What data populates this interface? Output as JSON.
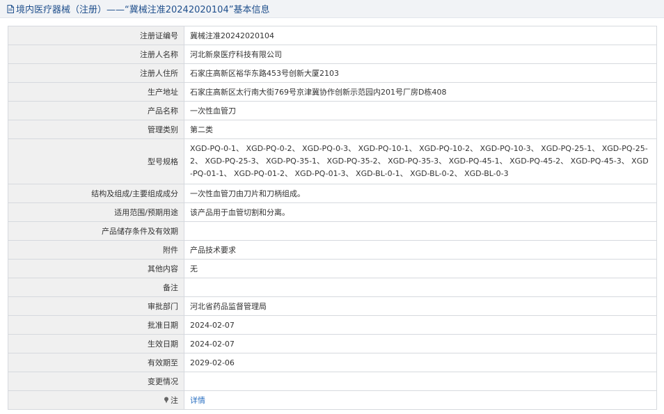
{
  "header": {
    "icon": "document-icon",
    "title": "境内医疗器械（注册）——“冀械注准20242020104”基本信息"
  },
  "rows": [
    {
      "label": "注册证编号",
      "value": "冀械注准20242020104"
    },
    {
      "label": "注册人名称",
      "value": "河北新泉医疗科技有限公司"
    },
    {
      "label": "注册人住所",
      "value": "石家庄高新区裕华东路453号创新大厦2103"
    },
    {
      "label": "生产地址",
      "value": "石家庄高新区太行南大街769号京津冀协作创新示范园内201号厂房D栋408"
    },
    {
      "label": "产品名称",
      "value": "一次性血管刀"
    },
    {
      "label": "管理类别",
      "value": "第二类"
    },
    {
      "label": "型号规格",
      "value": "XGD-PQ-0-1、 XGD-PQ-0-2、 XGD-PQ-0-3、 XGD-PQ-10-1、 XGD-PQ-10-2、 XGD-PQ-10-3、 XGD-PQ-25-1、 XGD-PQ-25-2、 XGD-PQ-25-3、 XGD-PQ-35-1、 XGD-PQ-35-2、 XGD-PQ-35-3、 XGD-PQ-45-1、 XGD-PQ-45-2、 XGD-PQ-45-3、 XGD-PQ-01-1、 XGD-PQ-01-2、 XGD-PQ-01-3、 XGD-BL-0-1、 XGD-BL-0-2、 XGD-BL-0-3"
    },
    {
      "label": "结构及组成/主要组成成分",
      "value": "一次性血管刀由刀片和刀柄组成。"
    },
    {
      "label": "适用范围/预期用途",
      "value": "该产品用于血管切割和分离。"
    },
    {
      "label": "产品储存条件及有效期",
      "value": ""
    },
    {
      "label": "附件",
      "value": "产品技术要求"
    },
    {
      "label": "其他内容",
      "value": "无"
    },
    {
      "label": "备注",
      "value": ""
    },
    {
      "label": "审批部门",
      "value": "河北省药品监督管理局"
    },
    {
      "label": "批准日期",
      "value": "2024-02-07"
    },
    {
      "label": "生效日期",
      "value": "2024-02-07"
    },
    {
      "label": "有效期至",
      "value": "2029-02-06"
    },
    {
      "label": "变更情况",
      "value": ""
    },
    {
      "label": "注",
      "value": "详情"
    }
  ],
  "colors": {
    "header_bg": "#f1f3f6",
    "header_text": "#1f4f8c",
    "label_bg": "#f0f0f0",
    "border": "#d6d9de",
    "link": "#2a6fc1"
  }
}
